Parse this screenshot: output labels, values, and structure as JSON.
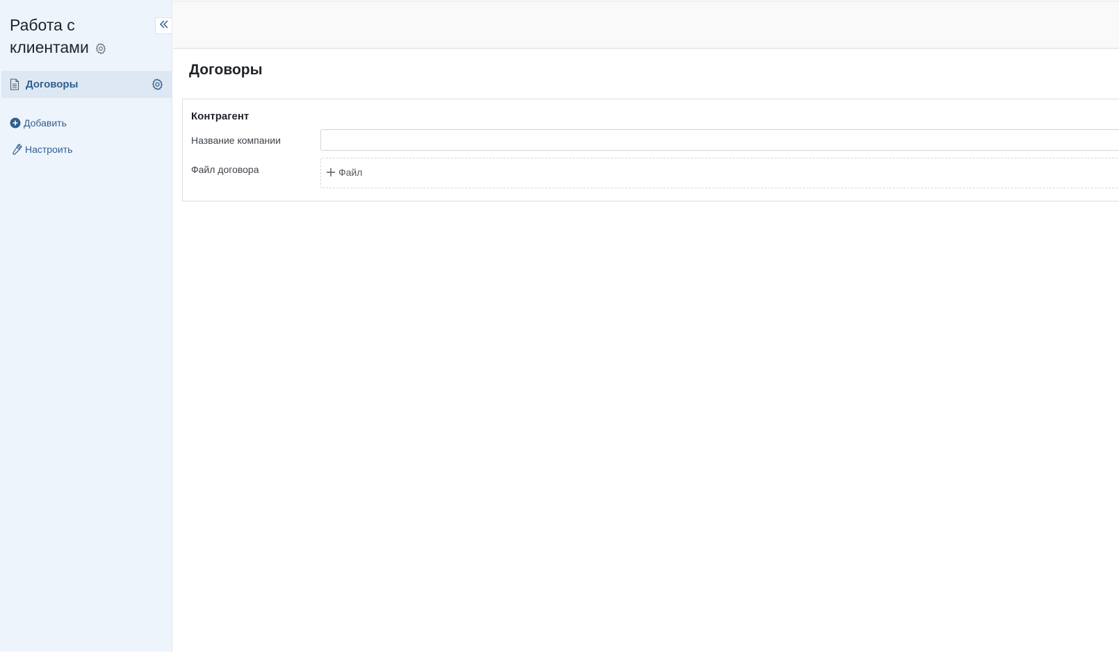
{
  "sidebar": {
    "app_title": "Работа с клиентами",
    "items": [
      {
        "label": "Договоры",
        "icon": "document-icon",
        "active": true
      }
    ],
    "actions": {
      "add_label": "Добавить",
      "config_label": "Настроить"
    }
  },
  "main": {
    "page_title": "Договоры",
    "form": {
      "section_title": "Контрагент",
      "fields": [
        {
          "label": "Название компании",
          "value": "",
          "placeholder": ""
        },
        {
          "label": "Файл договора",
          "button_label": "Файл"
        }
      ]
    }
  },
  "colors": {
    "accent": "#2f5f8f",
    "sidebar_bg": "#eef4fc",
    "active_item_bg": "#dde8f4"
  }
}
